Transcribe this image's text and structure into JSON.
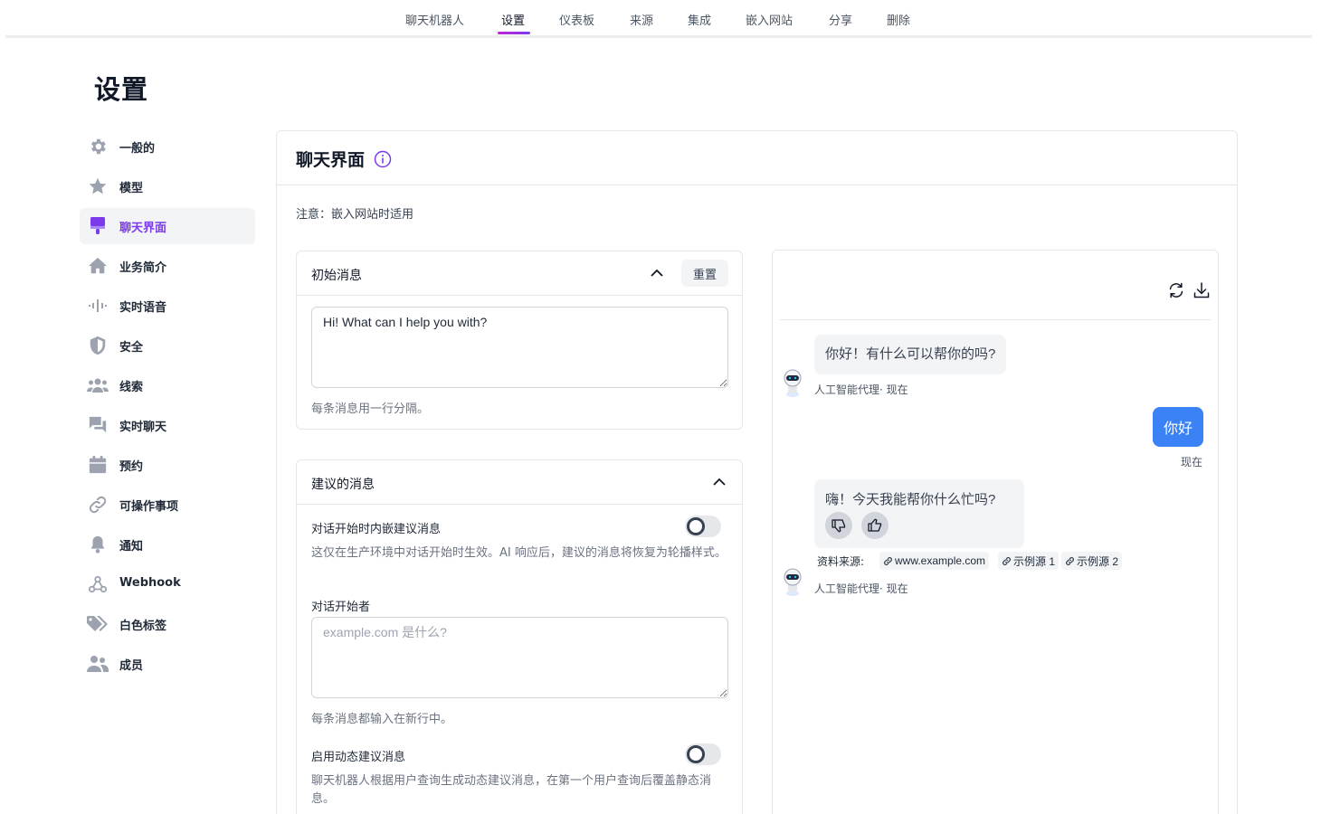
{
  "nav": {
    "tabs": [
      {
        "label": "聊天机器人"
      },
      {
        "label": "设置"
      },
      {
        "label": "仪表板"
      },
      {
        "label": "来源"
      },
      {
        "label": "集成"
      },
      {
        "label": "嵌入网站"
      },
      {
        "label": "分享"
      },
      {
        "label": "删除"
      }
    ],
    "active_tab": "设置"
  },
  "page": {
    "title": "设置"
  },
  "sidebar": {
    "active": "聊天界面",
    "items": [
      {
        "label": "一般的",
        "icon": "gear-icon"
      },
      {
        "label": "模型",
        "icon": "star-icon"
      },
      {
        "label": "聊天界面",
        "icon": "paintbrush-icon"
      },
      {
        "label": "业务简介",
        "icon": "home-icon"
      },
      {
        "label": "实时语音",
        "icon": "waveform-icon"
      },
      {
        "label": "安全",
        "icon": "shield-icon"
      },
      {
        "label": "线索",
        "icon": "users-group-icon"
      },
      {
        "label": "实时聊天",
        "icon": "chat-bubbles-icon"
      },
      {
        "label": "预约",
        "icon": "calendar-icon"
      },
      {
        "label": "可操作事项",
        "icon": "link-icon"
      },
      {
        "label": "通知",
        "icon": "bell-icon"
      },
      {
        "label": "Webhook",
        "icon": "webhook-icon"
      },
      {
        "label": "白色标签",
        "icon": "tags-icon"
      },
      {
        "label": "成员",
        "icon": "members-icon"
      }
    ]
  },
  "panel": {
    "title": "聊天界面",
    "note": "注意：嵌入网站时适用",
    "initial_messages": {
      "title": "初始消息",
      "reset_label": "重置",
      "value": "Hi! What can I help you with?",
      "hint": "每条消息用一行分隔。"
    },
    "suggested_messages": {
      "title": "建议的消息",
      "inline_label": "对话开始时内嵌建议消息",
      "inline_enabled": false,
      "inline_hint": "这仅在生产环境中对话开始时生效。AI 响应后，建议的消息将恢复为轮播样式。",
      "starter_label": "对话开始者",
      "starter_placeholder": "example.com 是什么?",
      "starter_hint": "每条消息都输入在新行中。",
      "dynamic_label": "启用动态建议消息",
      "dynamic_enabled": false,
      "dynamic_hint": "聊天机器人根据用户查询生成动态建议消息，在第一个用户查询后覆盖静态消息。"
    }
  },
  "preview": {
    "messages": [
      {
        "role": "bot",
        "text": "你好！有什么可以帮你的吗?",
        "meta": "人工智能代理· 现在"
      },
      {
        "role": "user",
        "text": "你好",
        "meta": "现在"
      },
      {
        "role": "bot",
        "text": "嗨！今天我能帮你什么忙吗?",
        "meta": "人工智能代理· 现在"
      }
    ],
    "sources_label": "资料来源:",
    "sources": [
      "www.example.com",
      "示例源 1",
      "示例源 2"
    ],
    "colors": {
      "user_bubble": "#3b82f6",
      "accent": "#7c3aed"
    }
  }
}
